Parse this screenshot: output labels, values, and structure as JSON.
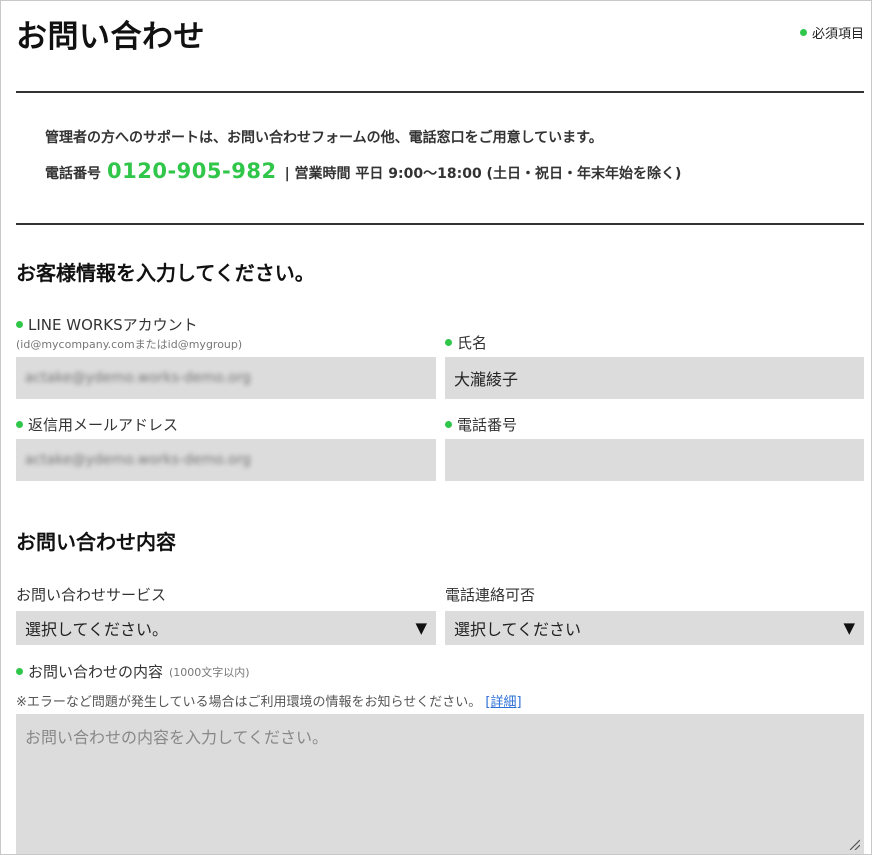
{
  "header": {
    "title": "お問い合わせ",
    "required_legend": "必須項目"
  },
  "support": {
    "intro": "管理者の方へのサポートは、お問い合わせフォームの他、電話窓口をご用意しています。",
    "phone_label": "電話番号",
    "phone_number": "0120-905-982",
    "hours_text": "| 営業時間 平日 9:00〜18:00 (土日・祝日・年末年始を除く)"
  },
  "customer_section": {
    "title": "お客様情報を入力してください。",
    "lineworks_label": "LINE WORKSアカウント",
    "lineworks_hint": "(id@mycompany.comまたはid@mygroup)",
    "lineworks_value": "actake@ydemo.works-demo.org",
    "name_label": "氏名",
    "name_value": "大瀧綾子",
    "reply_email_label": "返信用メールアドレス",
    "reply_email_value": "actake@ydemo.works-demo.org",
    "phone_label": "電話番号",
    "phone_value": ""
  },
  "inquiry_section": {
    "title": "お問い合わせ内容",
    "service_label": "お問い合わせサービス",
    "service_selected": "選択してください。",
    "contact_label": "電話連絡可否",
    "contact_selected": "選択してください",
    "content_label": "お問い合わせの内容",
    "content_limit": "(1000文字以内)",
    "note_text": "※エラーなど問題が発生している場合はご利用環境の情報をお知らせください。",
    "note_link": "[詳細]",
    "content_placeholder": "お問い合わせの内容を入力してください。"
  },
  "icons": {
    "dropdown": "▼"
  },
  "colors": {
    "accent_green": "#2fc64a",
    "field_bg": "#dcdcdc",
    "link_blue": "#2a6fd6"
  }
}
